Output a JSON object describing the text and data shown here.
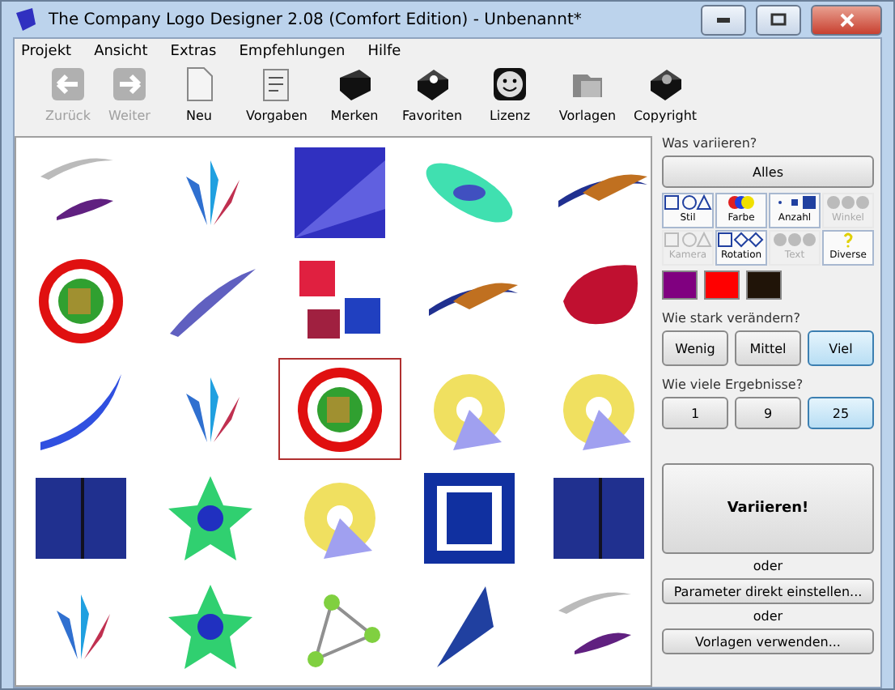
{
  "window": {
    "title": "The Company Logo Designer 2.08 (Comfort Edition) - Unbenannt*"
  },
  "menu": [
    "Projekt",
    "Ansicht",
    "Extras",
    "Empfehlungen",
    "Hilfe"
  ],
  "toolbar": [
    {
      "label": "Zurück",
      "kind": "back",
      "disabled": true
    },
    {
      "label": "Weiter",
      "kind": "forward",
      "disabled": true
    },
    {
      "label": "Neu",
      "kind": "page",
      "disabled": false
    },
    {
      "label": "Vorgaben",
      "kind": "notes",
      "disabled": false
    },
    {
      "label": "Merken",
      "kind": "book",
      "disabled": false
    },
    {
      "label": "Favoriten",
      "kind": "heartbook",
      "disabled": false
    },
    {
      "label": "Lizenz",
      "kind": "smiley",
      "disabled": false
    },
    {
      "label": "Vorlagen",
      "kind": "folders",
      "disabled": false
    },
    {
      "label": "Copyright",
      "kind": "cdbook",
      "disabled": false
    }
  ],
  "logos": [
    {
      "kind": "swoosh",
      "selected": false
    },
    {
      "kind": "feathers",
      "selected": false
    },
    {
      "kind": "rays",
      "selected": false
    },
    {
      "kind": "ellipse",
      "selected": false
    },
    {
      "kind": "streaks",
      "selected": false
    },
    {
      "kind": "ring",
      "selected": false
    },
    {
      "kind": "comet",
      "selected": false
    },
    {
      "kind": "cubes",
      "selected": false
    },
    {
      "kind": "streaks",
      "selected": false
    },
    {
      "kind": "blob",
      "selected": false
    },
    {
      "kind": "arc",
      "selected": false
    },
    {
      "kind": "feathers",
      "selected": false
    },
    {
      "kind": "ring",
      "selected": true
    },
    {
      "kind": "spiral",
      "selected": false
    },
    {
      "kind": "spiral",
      "selected": false
    },
    {
      "kind": "panels",
      "selected": false
    },
    {
      "kind": "star",
      "selected": false
    },
    {
      "kind": "spiral",
      "selected": false
    },
    {
      "kind": "tower",
      "selected": false
    },
    {
      "kind": "panels",
      "selected": false
    },
    {
      "kind": "feathers",
      "selected": false
    },
    {
      "kind": "star",
      "selected": false
    },
    {
      "kind": "triangle",
      "selected": false
    },
    {
      "kind": "flag",
      "selected": false
    },
    {
      "kind": "swoosh",
      "selected": false
    }
  ],
  "panel": {
    "heading": "Was variieren?",
    "all_button": "Alles",
    "toggles": [
      {
        "label": "Stil",
        "kind": "shapes",
        "disabled": false
      },
      {
        "label": "Farbe",
        "kind": "colors",
        "disabled": false
      },
      {
        "label": "Anzahl",
        "kind": "dots",
        "disabled": false
      },
      {
        "label": "Winkel",
        "kind": "circles",
        "disabled": true
      },
      {
        "label": "Kamera",
        "kind": "shapes",
        "disabled": true
      },
      {
        "label": "Rotation",
        "kind": "diamonds",
        "disabled": false
      },
      {
        "label": "Text",
        "kind": "circles",
        "disabled": true
      },
      {
        "label": "Diverse",
        "kind": "question",
        "disabled": false
      }
    ],
    "swatches": [
      {
        "color": "#800080"
      },
      {
        "color": "#ff0000"
      },
      {
        "color": "#201408"
      }
    ],
    "strength_heading": "Wie stark verändern?",
    "strength": [
      {
        "label": "Wenig",
        "selected": false
      },
      {
        "label": "Mittel",
        "selected": false
      },
      {
        "label": "Viel",
        "selected": true
      }
    ],
    "count_heading": "Wie viele Ergebnisse?",
    "count": [
      {
        "label": "1",
        "selected": false
      },
      {
        "label": "9",
        "selected": false
      },
      {
        "label": "25",
        "selected": true
      }
    ],
    "vary_button": "Variieren!",
    "or_1": "oder",
    "params_button": "Parameter direkt einstellen...",
    "or_2": "oder",
    "templates_button": "Vorlagen verwenden..."
  }
}
